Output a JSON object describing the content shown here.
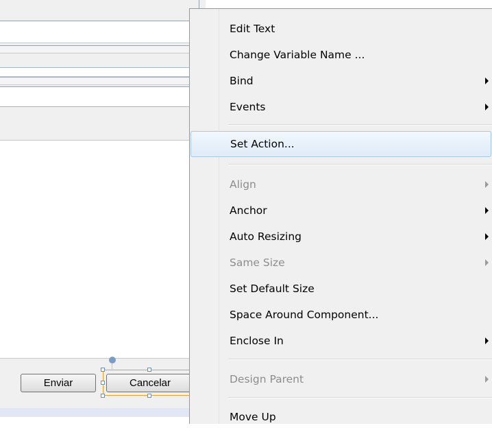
{
  "form": {
    "buttons": {
      "enviar_label": "Enviar",
      "cancelar_label": "Cancelar"
    }
  },
  "context_menu": {
    "items": [
      {
        "label": "Edit Text",
        "submenu": false,
        "disabled": false
      },
      {
        "label": "Change Variable Name ...",
        "submenu": false,
        "disabled": false
      },
      {
        "label": "Bind",
        "submenu": true,
        "disabled": false
      },
      {
        "label": "Events",
        "submenu": true,
        "disabled": false
      },
      {
        "label": "Set Action...",
        "submenu": false,
        "disabled": false,
        "highlighted": true
      },
      {
        "label": "Align",
        "submenu": true,
        "disabled": true
      },
      {
        "label": "Anchor",
        "submenu": true,
        "disabled": false
      },
      {
        "label": "Auto Resizing",
        "submenu": true,
        "disabled": false
      },
      {
        "label": "Same Size",
        "submenu": true,
        "disabled": true
      },
      {
        "label": "Set Default Size",
        "submenu": false,
        "disabled": false
      },
      {
        "label": "Space Around Component...",
        "submenu": false,
        "disabled": false
      },
      {
        "label": "Enclose In",
        "submenu": true,
        "disabled": false
      },
      {
        "label": "Design Parent",
        "submenu": true,
        "disabled": true
      },
      {
        "label": "Move Up",
        "submenu": false,
        "disabled": false
      }
    ]
  },
  "colors": {
    "menu_background": "#f0f0f0",
    "highlight_border": "#a8c8e8",
    "selection_border": "#f0a020",
    "disabled_text": "#8d8d8d"
  }
}
